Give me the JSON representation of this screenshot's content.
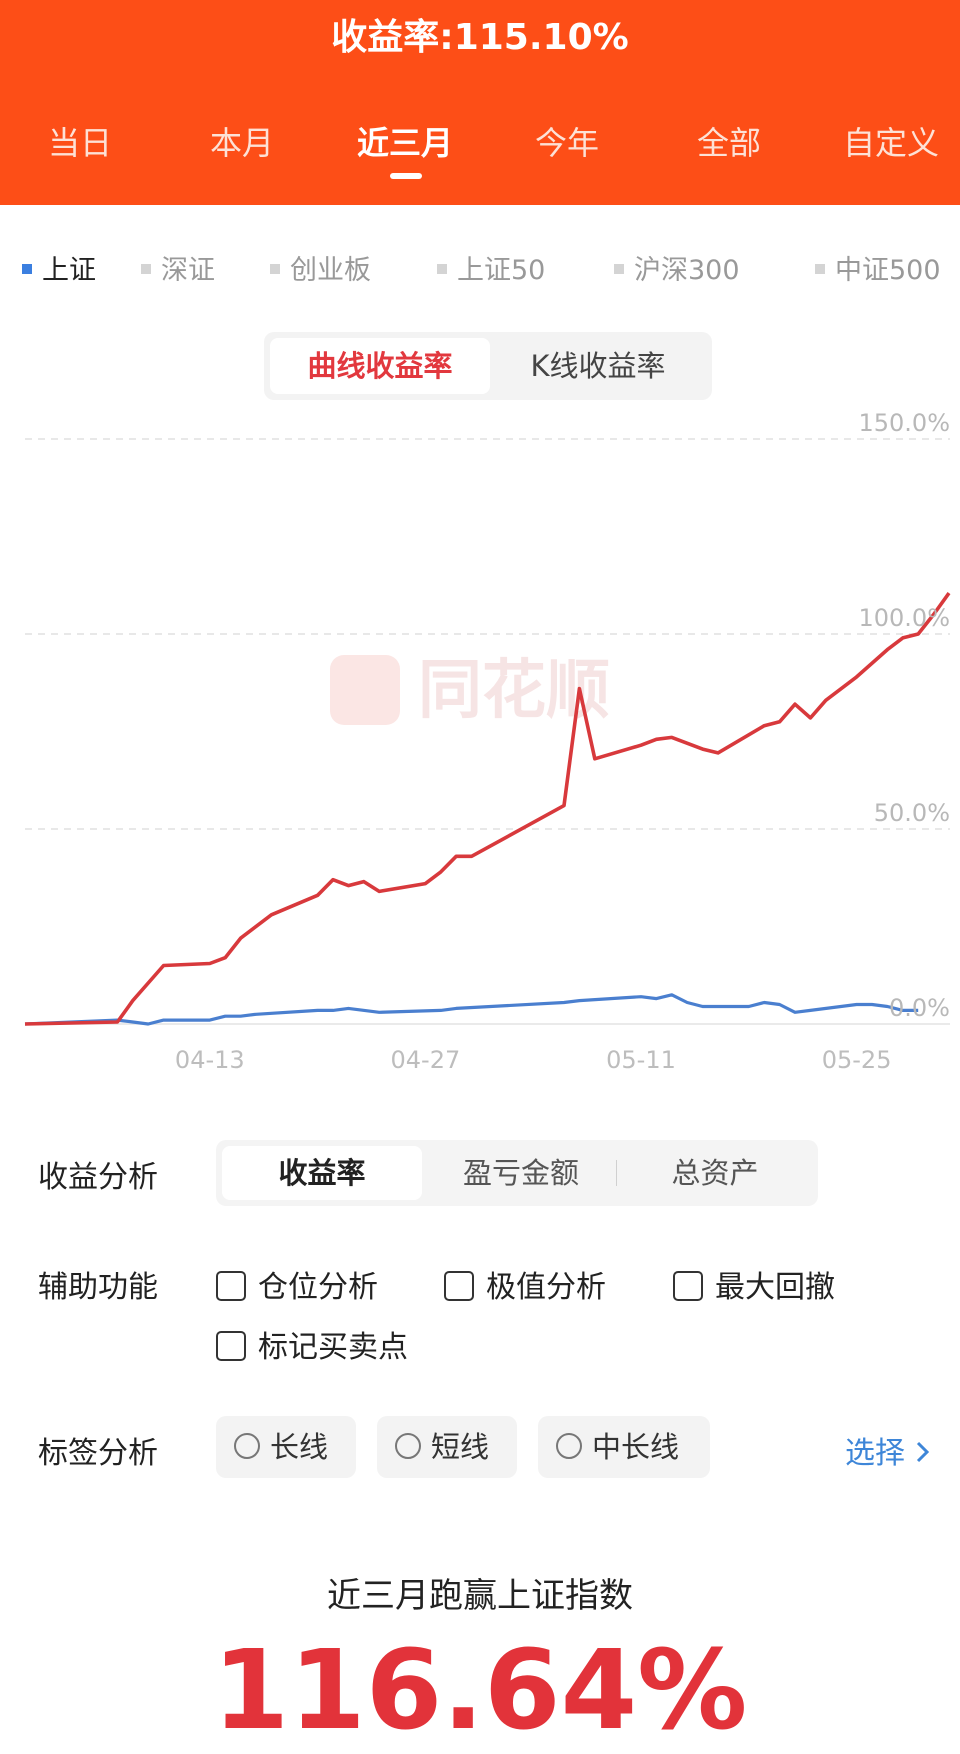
{
  "header": {
    "return_rate_text": "收益率:115.10%",
    "tabs": [
      "当日",
      "本月",
      "近三月",
      "今年",
      "全部",
      "自定义"
    ],
    "active_tab": "近三月"
  },
  "indices": {
    "items": [
      "上证",
      "深证",
      "创业板",
      "上证50",
      "沪深300",
      "中证500"
    ],
    "active": "上证"
  },
  "curve_toggle": {
    "curve_label": "曲线收益率",
    "kline_label": "K线收益率"
  },
  "watermark_text": "同花顺",
  "colors": {
    "brand_orange": "#fd4e17",
    "account_line": "#d8393c",
    "index_line": "#4a7fcf",
    "accent_red": "#e2333a",
    "link_blue": "#3e86d8"
  },
  "chart_data": {
    "type": "line",
    "y_ticks": [
      "150.0%",
      "100.0%",
      "50.0%",
      "0.0%"
    ],
    "x_ticks": [
      "04-13",
      "04-27",
      "05-11",
      "05-25"
    ],
    "ylim": [
      0,
      150
    ],
    "grid": true,
    "series": [
      {
        "role": "account",
        "points": [
          [
            0,
            0
          ],
          [
            6,
            0.5
          ],
          [
            7,
            6
          ],
          [
            9,
            15
          ],
          [
            12,
            15.5
          ],
          [
            13,
            17
          ],
          [
            14,
            22
          ],
          [
            16,
            28
          ],
          [
            19,
            33
          ],
          [
            20,
            37
          ],
          [
            21,
            35.5
          ],
          [
            22,
            36.5
          ],
          [
            23,
            34
          ],
          [
            26,
            36
          ],
          [
            27,
            39
          ],
          [
            28,
            43
          ],
          [
            29,
            43
          ],
          [
            35,
            56
          ],
          [
            36,
            86
          ],
          [
            37,
            68
          ],
          [
            40,
            71.5
          ],
          [
            41,
            73
          ],
          [
            42,
            73.5
          ],
          [
            44,
            70.5
          ],
          [
            45,
            69.5
          ],
          [
            48,
            76.5
          ],
          [
            49,
            77.5
          ],
          [
            50,
            82
          ],
          [
            51,
            78.5
          ],
          [
            52,
            83
          ],
          [
            54,
            89
          ],
          [
            56,
            96
          ],
          [
            57,
            99
          ],
          [
            58,
            100
          ],
          [
            59,
            105
          ],
          [
            60,
            110.5
          ]
        ]
      },
      {
        "role": "index",
        "points": [
          [
            0,
            0
          ],
          [
            6,
            1
          ],
          [
            7,
            0.5
          ],
          [
            8,
            0
          ],
          [
            9,
            1
          ],
          [
            12,
            1
          ],
          [
            13,
            2
          ],
          [
            14,
            2
          ],
          [
            15,
            2.5
          ],
          [
            19,
            3.5
          ],
          [
            20,
            3.5
          ],
          [
            21,
            4
          ],
          [
            23,
            3
          ],
          [
            27,
            3.5
          ],
          [
            28,
            4
          ],
          [
            35,
            5.5
          ],
          [
            36,
            6
          ],
          [
            40,
            7
          ],
          [
            41,
            6.5
          ],
          [
            42,
            7.5
          ],
          [
            43,
            5.5
          ],
          [
            44,
            4.5
          ],
          [
            47,
            4.5
          ],
          [
            48,
            5.5
          ],
          [
            49,
            5
          ],
          [
            50,
            3
          ],
          [
            51,
            3.5
          ],
          [
            54,
            5
          ],
          [
            55,
            5
          ],
          [
            56,
            4.5
          ],
          [
            57,
            3.5
          ],
          [
            58,
            3.5
          ]
        ]
      }
    ]
  },
  "analysis": {
    "label": "收益分析",
    "options": [
      "收益率",
      "盈亏金额",
      "总资产"
    ],
    "active": "收益率"
  },
  "aux": {
    "label": "辅助功能",
    "options": [
      "仓位分析",
      "极值分析",
      "最大回撤",
      "标记买卖点"
    ]
  },
  "tags": {
    "label": "标签分析",
    "options": [
      "长线",
      "短线",
      "中长线"
    ],
    "select_label": "选择"
  },
  "summary": {
    "title": "近三月跑赢上证指数",
    "value": "116.64%"
  }
}
